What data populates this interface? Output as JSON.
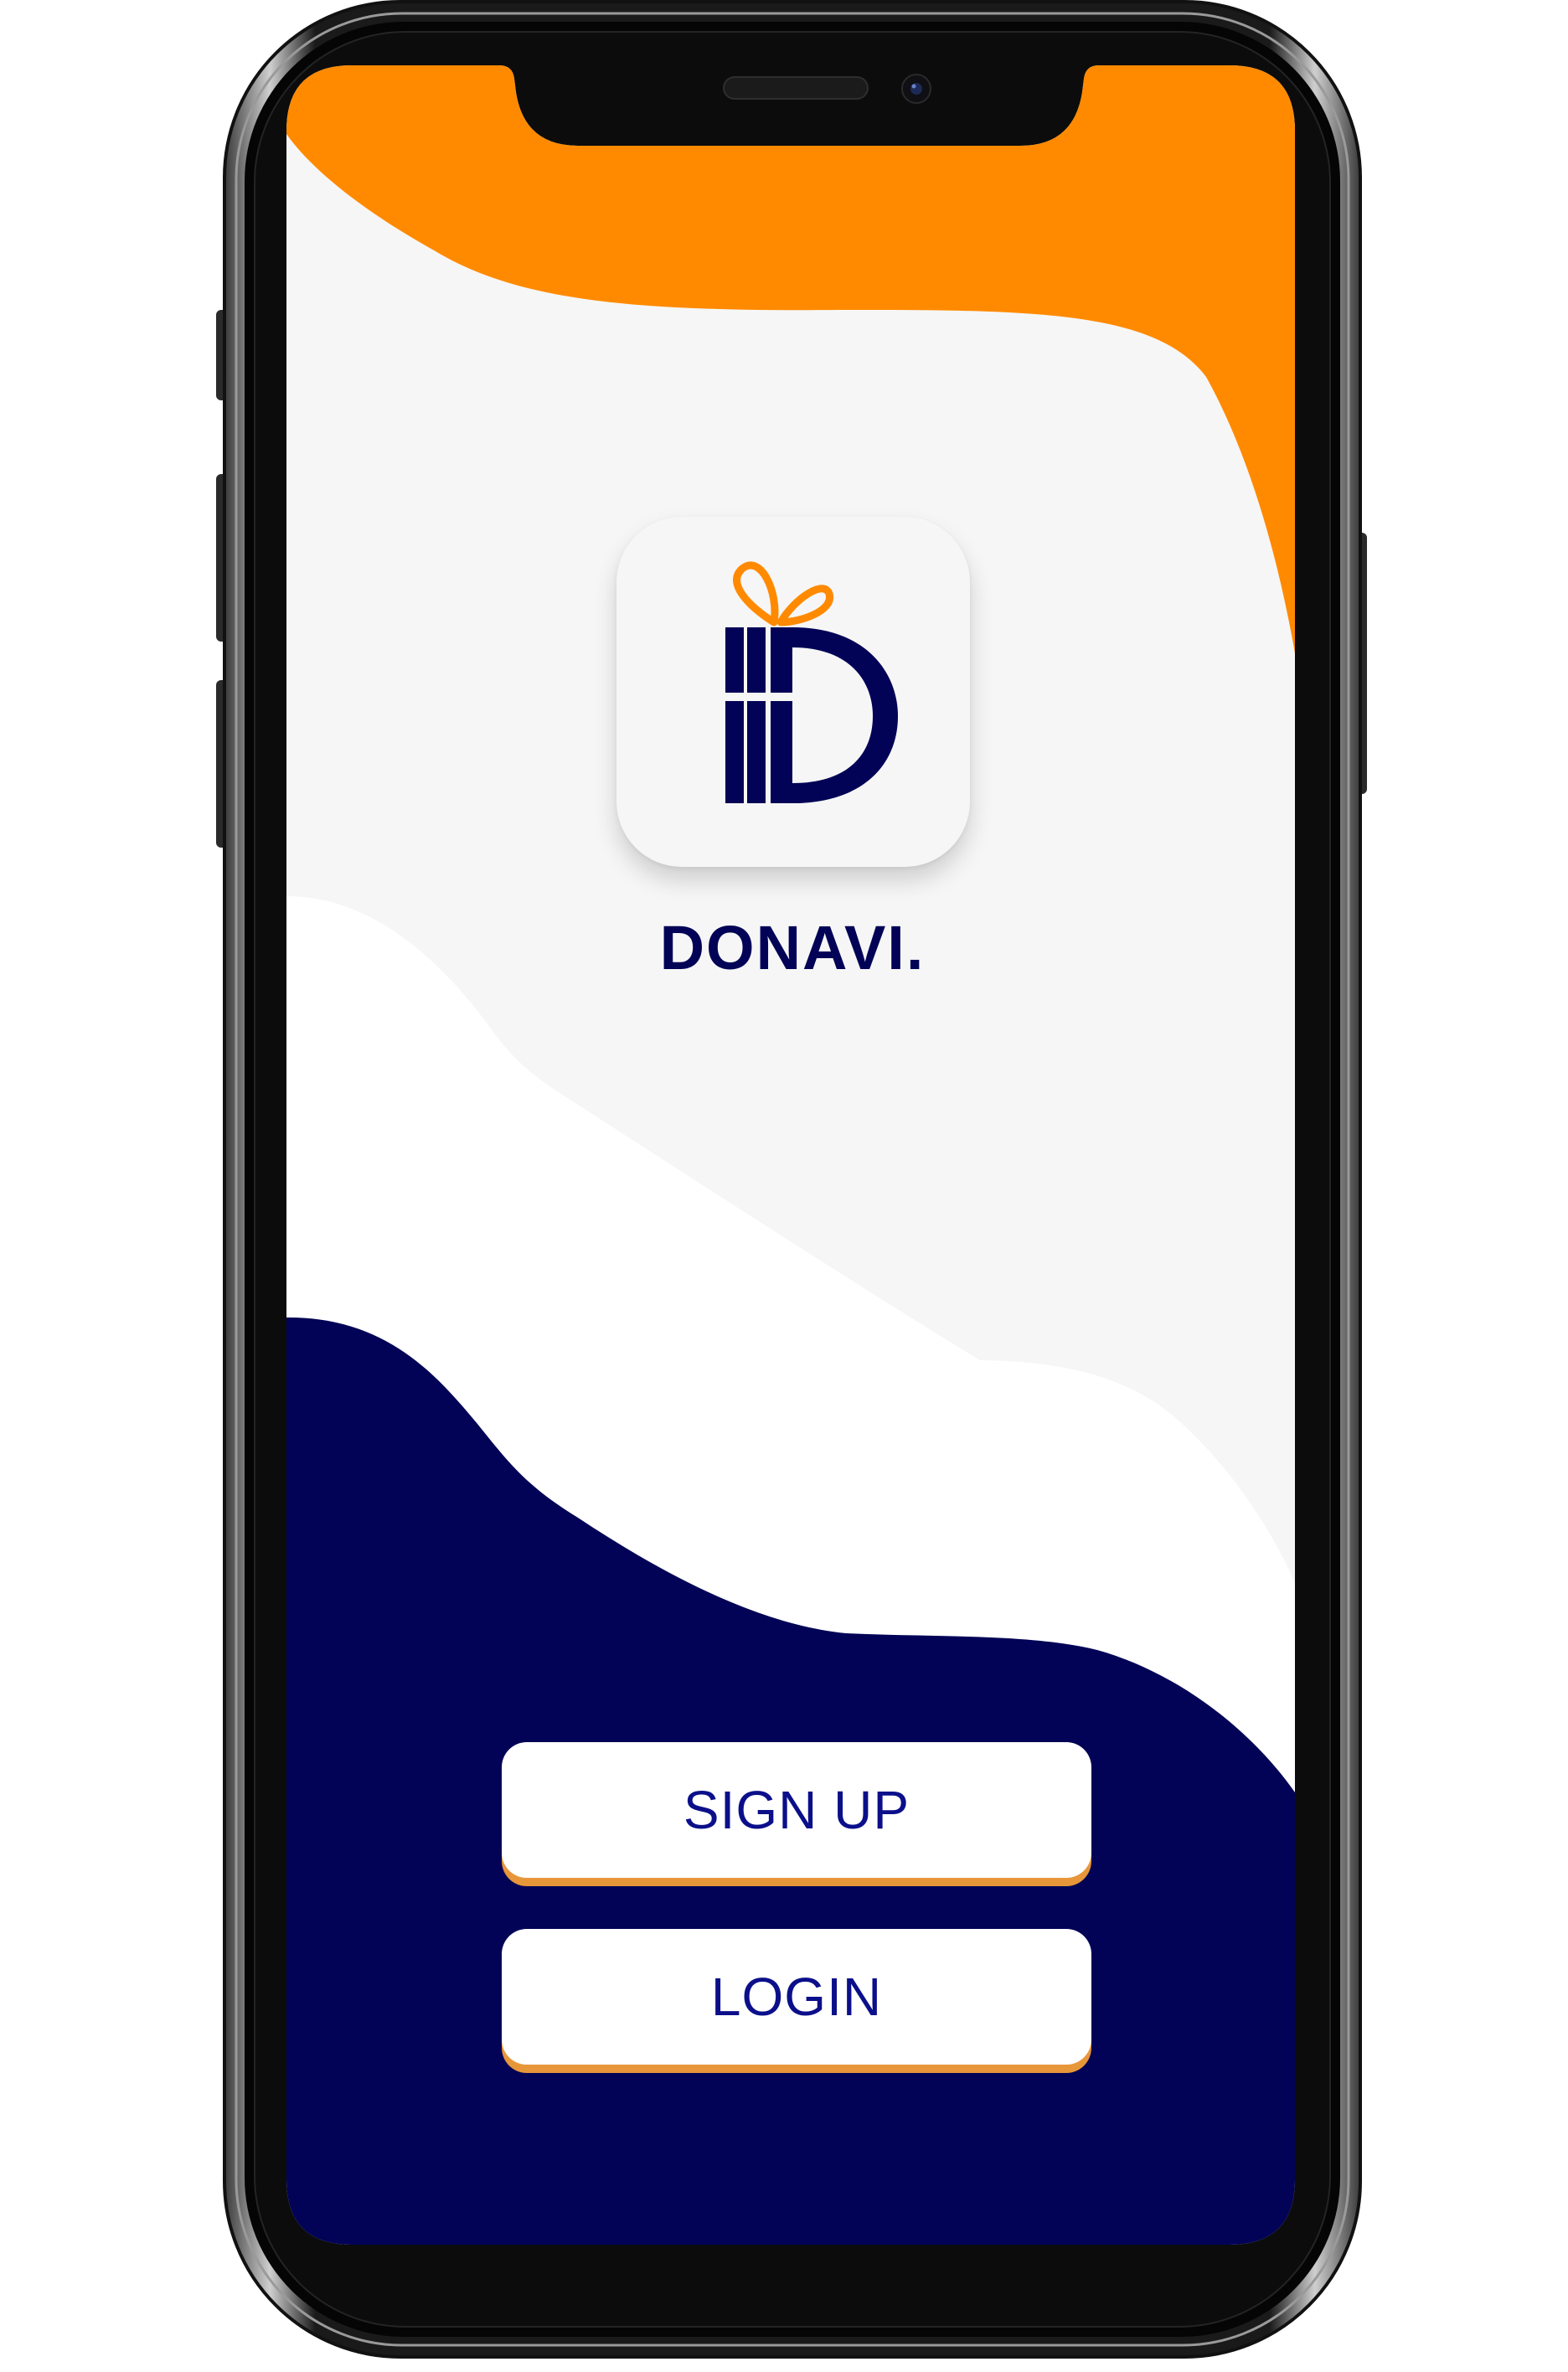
{
  "app": {
    "name": "DONAVI."
  },
  "buttons": {
    "signup_label": "SIGN UP",
    "login_label": "LOGIN"
  },
  "colors": {
    "orange": "#ff8a00",
    "navy": "#020356",
    "light_gray": "#f6f6f6",
    "white": "#ffffff",
    "button_text": "#0b0f8a",
    "button_shadow": "#e8963a"
  },
  "icons": {
    "logo": "gift-letter-d-logo-icon",
    "camera": "front-camera-icon",
    "speaker": "earpiece-speaker-icon"
  }
}
